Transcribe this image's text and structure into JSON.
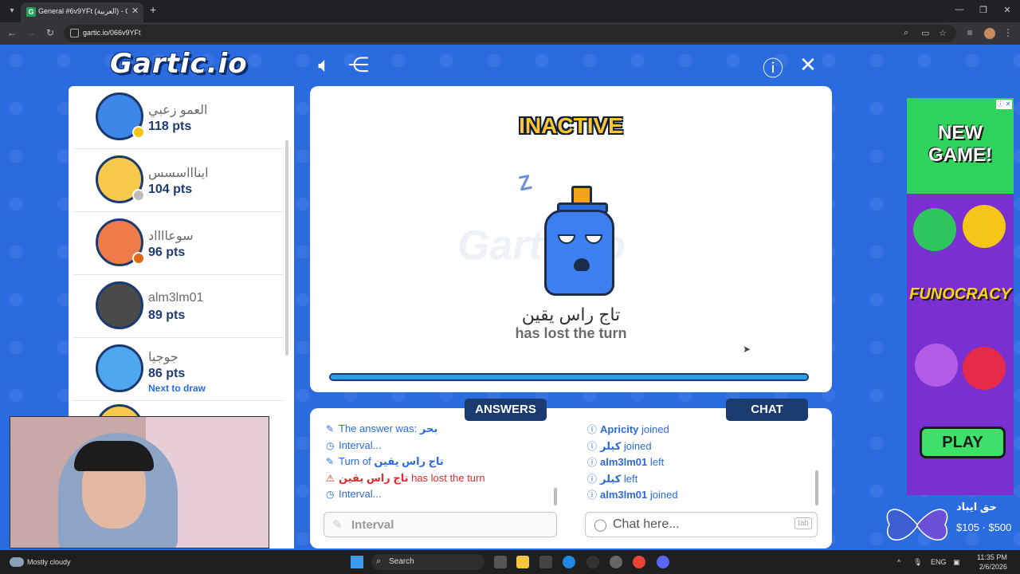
{
  "browser": {
    "tab_title": "General #6v9YFt (العربية) - Gartic",
    "url": "gartic.io/066v9YFt"
  },
  "game": {
    "logo": "Gartic.io",
    "status_title": "INACTIVE",
    "watermark": "Gartic.io",
    "zzz": "Z",
    "turn_player": "تاج راس يقين",
    "turn_message": "has lost the turn",
    "progress_fraction": 1.0
  },
  "players": [
    {
      "name": "العمو زعبي",
      "points": "118 pts",
      "dot_color": "#f5c518",
      "avatar_color": "#3e86e8",
      "note": ""
    },
    {
      "name": "ايناااسسس",
      "points": "104 pts",
      "dot_color": "#bdbdbd",
      "avatar_color": "#f7c94b",
      "note": ""
    },
    {
      "name": "سوعااااد",
      "points": "96 pts",
      "dot_color": "#e06a16",
      "avatar_color": "#ef7b4a",
      "note": ""
    },
    {
      "name": "alm3lm01",
      "points": "89 pts",
      "dot_color": "",
      "avatar_color": "#4a4a4a",
      "note": ""
    },
    {
      "name": "جوجيا",
      "points": "86 pts",
      "dot_color": "",
      "avatar_color": "#4fa8ef",
      "note": "Next to draw"
    }
  ],
  "answers": {
    "label": "ANSWERS",
    "lines": [
      {
        "icon": "pencil-icon",
        "prefix": "The answer was: ",
        "hl": "بحر",
        "suffix": ""
      },
      {
        "icon": "clock-icon",
        "prefix": "Interval...",
        "hl": "",
        "suffix": ""
      },
      {
        "icon": "pencil-icon",
        "prefix": "Turn of ",
        "hl": "تاج راس يقين",
        "suffix": ""
      },
      {
        "icon": "warning-icon",
        "prefix": "",
        "hl": "تاج راس يقين",
        "suffix": " has lost the turn"
      },
      {
        "icon": "clock-icon",
        "prefix": "Interval...",
        "hl": "",
        "suffix": ""
      }
    ],
    "input_placeholder": "Interval"
  },
  "chat": {
    "label": "CHAT",
    "lines": [
      {
        "user": "Apricity",
        "action": " joined"
      },
      {
        "user": "كيلر",
        "action": " joined"
      },
      {
        "user": "alm3lm01",
        "action": " left"
      },
      {
        "user": "كيلر",
        "action": " left"
      },
      {
        "user": "alm3lm01",
        "action": " joined"
      }
    ],
    "input_placeholder": "Chat here...",
    "tab_key": "tab"
  },
  "ad": {
    "headline": "NEW GAME!",
    "brand": "FUNOCRACY",
    "cta": "PLAY"
  },
  "promo": {
    "name": "حق ايباد",
    "price": "$105 · $500"
  },
  "taskbar": {
    "weather": "Mostly cloudy",
    "search": "Search",
    "lang": "ENG",
    "time": "11:35 PM",
    "date": "2/6/2026"
  }
}
